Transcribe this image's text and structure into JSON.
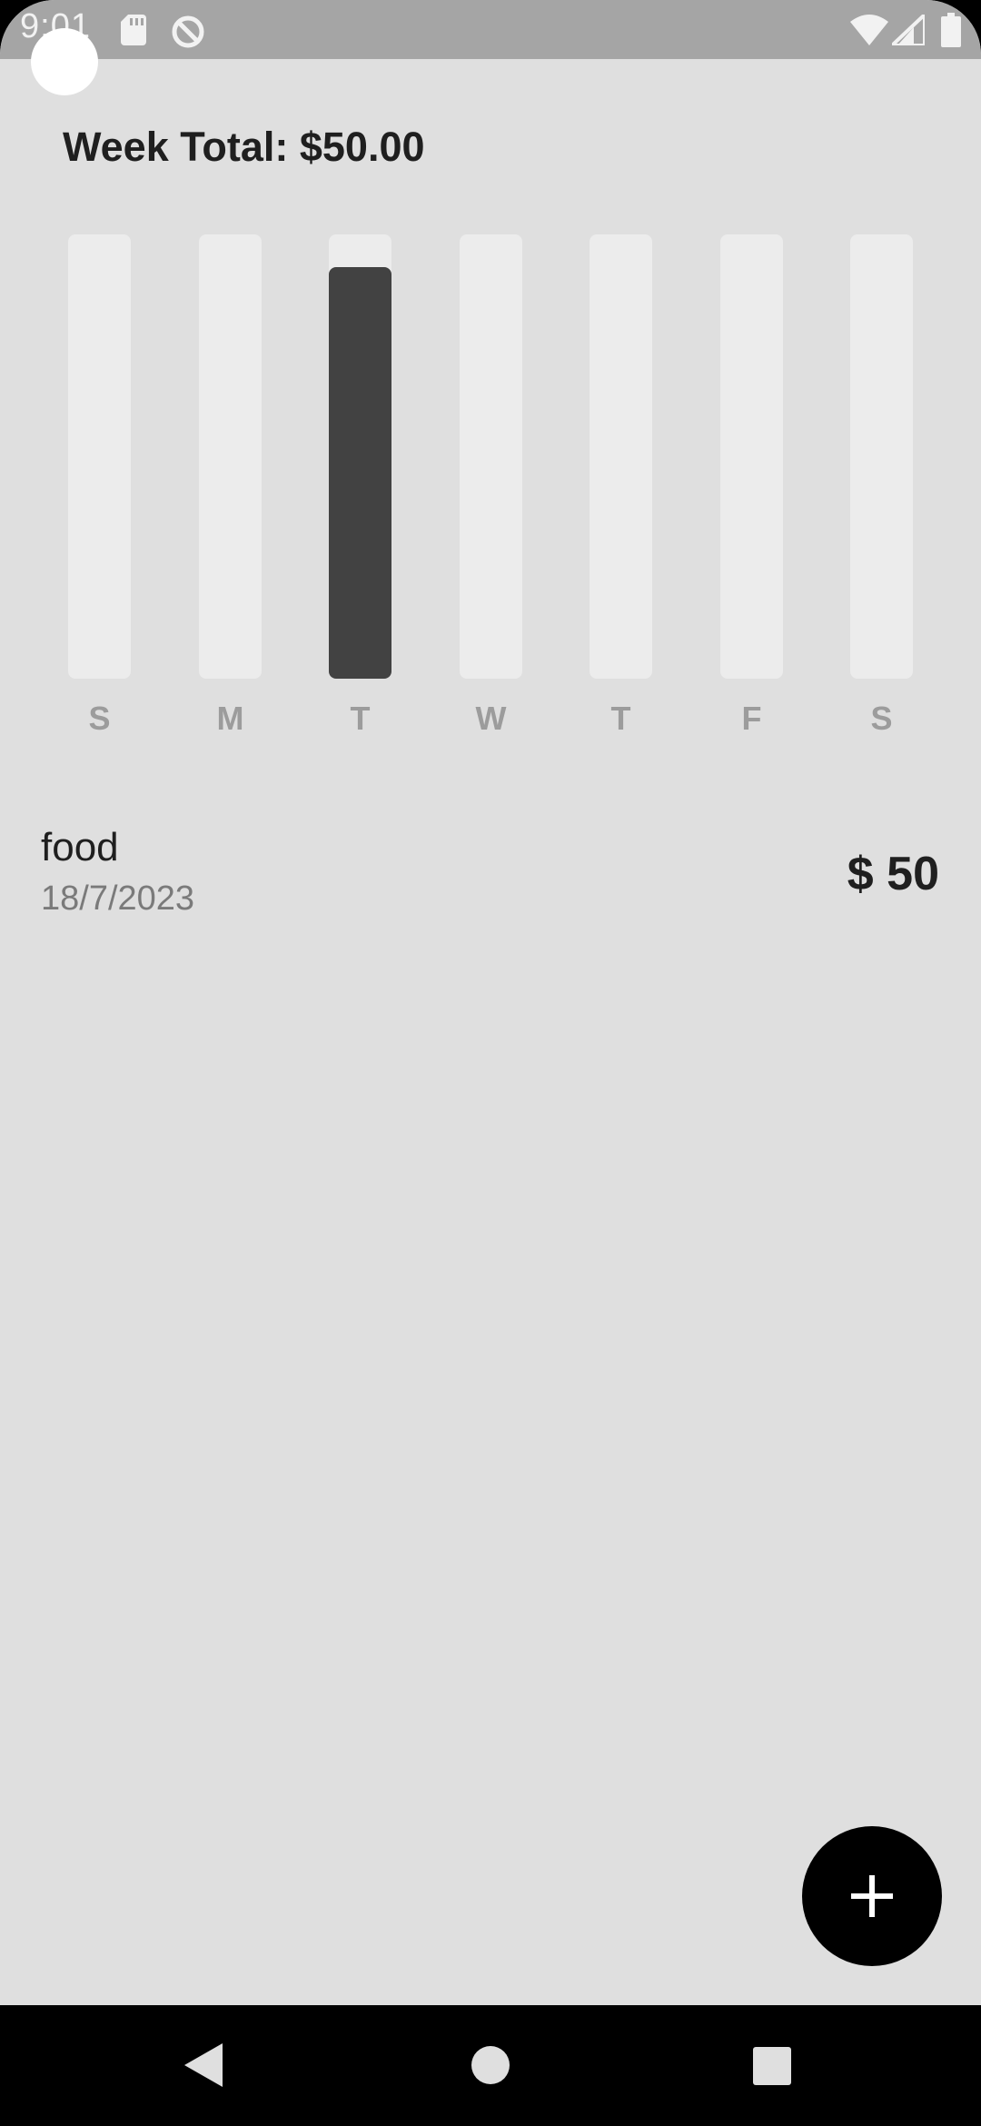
{
  "status_bar": {
    "time": "9:01",
    "icons": [
      "sd-card-icon",
      "data-saver-icon",
      "wifi-icon",
      "cell-signal-icon",
      "battery-icon"
    ]
  },
  "header": {
    "week_total": "Week Total: $50.00"
  },
  "chart_data": {
    "type": "bar",
    "categories": [
      "S",
      "M",
      "T",
      "W",
      "T",
      "F",
      "S"
    ],
    "values": [
      0,
      0,
      50,
      0,
      0,
      0,
      0
    ],
    "ylim": [
      0,
      54
    ],
    "bar_color": "#424242",
    "track_color": "#ececec"
  },
  "transactions": [
    {
      "title": "food",
      "date": "18/7/2023",
      "amount": "$ 50"
    }
  ],
  "fab": {
    "icon": "plus-icon"
  },
  "nav_bar": {
    "icons": [
      "back-icon",
      "home-icon",
      "recents-icon"
    ]
  },
  "colors": {
    "background": "#dfdfdf",
    "status_bar": "#a5a5a5",
    "fab": "#000000"
  }
}
